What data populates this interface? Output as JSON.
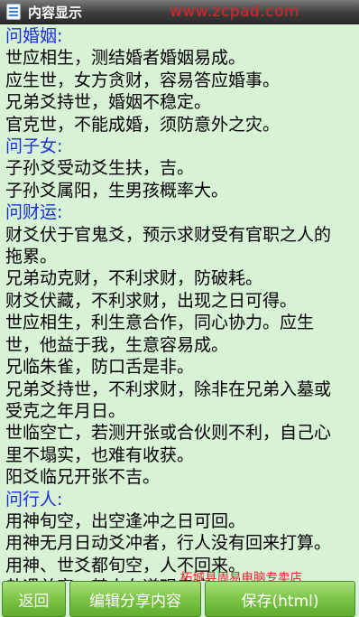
{
  "titlebar": {
    "title": "内容显示",
    "watermark": "www.zcpad.com"
  },
  "content_lines": [
    {
      "text": "问婚姻:",
      "heading": true
    },
    {
      "text": "世应相生，测结婚者婚姻易成。"
    },
    {
      "text": "应生世，女方贪财，容易答应婚事。"
    },
    {
      "text": "兄弟爻持世，婚姻不稳定。"
    },
    {
      "text": "官克世，不能成婚，须防意外之灾。"
    },
    {
      "text": "问子女:",
      "heading": true
    },
    {
      "text": "子孙爻受动爻生扶，吉。"
    },
    {
      "text": "子孙爻属阳，生男孩概率大。"
    },
    {
      "text": "问财运:",
      "heading": true
    },
    {
      "text": "财爻伏于官鬼爻，预示求财受有官职之人的"
    },
    {
      "text": "拖累。"
    },
    {
      "text": "兄弟动克财，不利求财，防破耗。"
    },
    {
      "text": "财爻伏藏，不利求财，出现之日可得。"
    },
    {
      "text": "世应相生，利生意合作，同心协力。应生"
    },
    {
      "text": "世，他益于我，生意容易成。"
    },
    {
      "text": "兄临朱雀，防口舌是非。"
    },
    {
      "text": "兄弟爻持世，不利求财，除非在兄弟入墓或"
    },
    {
      "text": "受克之年月日。"
    },
    {
      "text": "世临空亡，若测开张或合伙则不利，自己心"
    },
    {
      "text": "里不塌实，也难有收获。"
    },
    {
      "text": "阳爻临兄开张不吉。"
    },
    {
      "text": "问行人:",
      "heading": true
    },
    {
      "text": "用神旬空，出空逢冲之日可回。"
    },
    {
      "text": "用神无月日动爻冲者，行人没有回来打算。"
    },
    {
      "text": "用神、世爻都旬空，人不回来。"
    },
    {
      "text": "卦遇兑宫，其人在道观寺庙。"
    }
  ],
  "shop_watermark": "柘城县周易电脑专卖店",
  "buttons": {
    "back": "返回",
    "share": "编辑分享内容",
    "save": "保存(html)"
  }
}
